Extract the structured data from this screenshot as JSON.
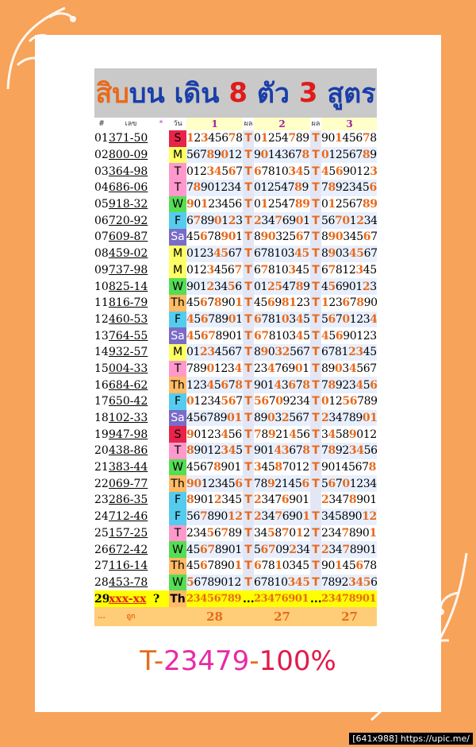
{
  "title": {
    "parts": [
      {
        "text": "สิบ",
        "color": "#e86a1c"
      },
      {
        "text": "บน ",
        "color": "#1a3ea8"
      },
      {
        "text": "เดิน ",
        "color": "#1a3ea8"
      },
      {
        "text": "8 ",
        "color": "#e01b1b"
      },
      {
        "text": "ตัว ",
        "color": "#1a3ea8"
      },
      {
        "text": "3 ",
        "color": "#e01b1b"
      },
      {
        "text": "สูตร",
        "color": "#1a3ea8"
      }
    ]
  },
  "header": {
    "num": "#",
    "code": "เลข",
    "star": "*",
    "day": "วัน",
    "set1": "1",
    "res1": "ผล",
    "set2": "2",
    "res2": "ผล",
    "set3": "3",
    "res3": "ผล"
  },
  "colors": {
    "S": "#e8234a",
    "M": "#ffff66",
    "T": "#ff99cc",
    "W": "#55dd55",
    "F": "#55ccee",
    "Sa": "#7a6bc9",
    "Th": "#ffbb66",
    "hit": "#e86a1c"
  },
  "rows": [
    {
      "n": "01",
      "code": "371-50",
      "day": "S",
      "s1": "12345678",
      "r1": "T",
      "s2": "01254789",
      "r2": "T",
      "s3": "90145678",
      "r3": "T"
    },
    {
      "n": "02",
      "code": "800-09",
      "day": "M",
      "s1": "56789012",
      "r1": "T",
      "s2": "90143678",
      "r2": "T",
      "s3": "01256789",
      "r3": "T"
    },
    {
      "n": "03",
      "code": "364-98",
      "day": "T",
      "s1": "01234567",
      "r1": "T",
      "s2": "67810345",
      "r2": "T",
      "s3": "45690123",
      "r3": "T"
    },
    {
      "n": "04",
      "code": "686-06",
      "day": "T",
      "s1": "78901234",
      "r1": "T",
      "s2": "01254789",
      "r2": "T",
      "s3": "78923456",
      "r3": "T"
    },
    {
      "n": "05",
      "code": "918-32",
      "day": "W",
      "s1": "90123456",
      "r1": "T",
      "s2": "01254789",
      "r2": "T",
      "s3": "01256789",
      "r3": "T"
    },
    {
      "n": "06",
      "code": "720-92",
      "day": "F",
      "s1": "67890123",
      "r1": "T",
      "s2": "23476901",
      "r2": "T",
      "s3": "56701234",
      "r3": "T"
    },
    {
      "n": "07",
      "code": "609-87",
      "day": "Sa",
      "s1": "45678901",
      "r1": "T",
      "s2": "89032567",
      "r2": "T",
      "s3": "89034567",
      "r3": "T"
    },
    {
      "n": "08",
      "code": "459-02",
      "day": "M",
      "s1": "01234567",
      "r1": "T",
      "s2": "67810345",
      "r2": "T",
      "s3": "89034567",
      "r3": "T"
    },
    {
      "n": "09",
      "code": "737-98",
      "day": "M",
      "s1": "01234567",
      "r1": "T",
      "s2": "67810345",
      "r2": "T",
      "s3": "67812345",
      "r3": "T"
    },
    {
      "n": "10",
      "code": "825-14",
      "day": "W",
      "s1": "90123456",
      "r1": "T",
      "s2": "01254789",
      "r2": "T",
      "s3": "45690123",
      "r3": "T"
    },
    {
      "n": "11",
      "code": "816-79",
      "day": "Th",
      "s1": "45678901",
      "r1": "T",
      "s2": "45698123",
      "r2": "T",
      "s3": "12367890",
      "r3": "T"
    },
    {
      "n": "12",
      "code": "460-53",
      "day": "F",
      "s1": "45678901",
      "r1": "T",
      "s2": "67810345",
      "r2": "T",
      "s3": "56701234",
      "r3": "T"
    },
    {
      "n": "13",
      "code": "764-55",
      "day": "Sa",
      "s1": "45678901",
      "r1": "T",
      "s2": "67810345",
      "r2": "T",
      "s3": "45690123",
      "r3": "T"
    },
    {
      "n": "14",
      "code": "932-57",
      "day": "M",
      "s1": "01234567",
      "r1": "T",
      "s2": "89032567",
      "r2": "T",
      "s3": "67812345",
      "r3": "T"
    },
    {
      "n": "15",
      "code": "004-33",
      "day": "T",
      "s1": "78901234",
      "r1": "T",
      "s2": "23476901",
      "r2": "T",
      "s3": "89034567",
      "r3": "T"
    },
    {
      "n": "16",
      "code": "684-62",
      "day": "Th",
      "s1": "12345678",
      "r1": "T",
      "s2": "90143678",
      "r2": "T",
      "s3": "78923456",
      "r3": "T"
    },
    {
      "n": "17",
      "code": "650-42",
      "day": "F",
      "s1": "01234567",
      "r1": "T",
      "s2": "56709234",
      "r2": "T",
      "s3": "01256789",
      "r3": "T"
    },
    {
      "n": "18",
      "code": "102-33",
      "day": "Sa",
      "s1": "45678901",
      "r1": "T",
      "s2": "89032567",
      "r2": "T",
      "s3": "23478901",
      "r3": "T"
    },
    {
      "n": "19",
      "code": "947-98",
      "day": "S",
      "s1": "90123456",
      "r1": "T",
      "s2": "78921456",
      "r2": "T",
      "s3": "34589012",
      "r3": "T"
    },
    {
      "n": "20",
      "code": "438-86",
      "day": "T",
      "s1": "89012345",
      "r1": "T",
      "s2": "90143678",
      "r2": "T",
      "s3": "78923456",
      "r3": "T"
    },
    {
      "n": "21",
      "code": "383-44",
      "day": "W",
      "s1": "45678901",
      "r1": "T",
      "s2": "34587012",
      "r2": "T",
      "s3": "90145678",
      "r3": "T"
    },
    {
      "n": "22",
      "code": "069-77",
      "day": "Th",
      "s1": "90123456",
      "r1": "T",
      "s2": "78921456",
      "r2": "T",
      "s3": "56701234",
      "r3": "T"
    },
    {
      "n": "23",
      "code": "286-35",
      "day": "F",
      "s1": "89012345",
      "r1": "T",
      "s2": "23476901",
      "r2": "",
      "s3": "23478901",
      "r3": "T"
    },
    {
      "n": "24",
      "code": "712-46",
      "day": "F",
      "s1": "56789012",
      "r1": "T",
      "s2": "23476901",
      "r2": "T",
      "s3": "34589012",
      "r3": "T"
    },
    {
      "n": "25",
      "code": "157-25",
      "day": "T",
      "s1": "23456789",
      "r1": "T",
      "s2": "34587012",
      "r2": "T",
      "s3": "23478901",
      "r3": ""
    },
    {
      "n": "26",
      "code": "672-42",
      "day": "W",
      "s1": "45678901",
      "r1": "T",
      "s2": "56709234",
      "r2": "T",
      "s3": "23478901",
      "r3": "T"
    },
    {
      "n": "27",
      "code": "116-14",
      "day": "Th",
      "s1": "45678901",
      "r1": "T",
      "s2": "67810345",
      "r2": "T",
      "s3": "90145678",
      "r3": "T"
    },
    {
      "n": "28",
      "code": "453-78",
      "day": "W",
      "s1": "56789012",
      "r1": "T",
      "s2": "67810345",
      "r2": "T",
      "s3": "78923456",
      "r3": "T"
    }
  ],
  "pending": {
    "n": "29",
    "code": "xxx-xx",
    "star": "?",
    "day": "Th",
    "s1": "23456789",
    "r1": "...",
    "s2": "23476901",
    "r2": "...",
    "s3": "23478901",
    "r3": "..."
  },
  "footer": {
    "dots": "...",
    "label": "ถูก",
    "c1": "28",
    "c2": "27",
    "c3": "27"
  },
  "bottom": {
    "prefix": "T",
    "dash1": "-",
    "number": "23479",
    "dash2": "-",
    "pct": "100%"
  },
  "watermark": "[641x988] https://upic.me/"
}
